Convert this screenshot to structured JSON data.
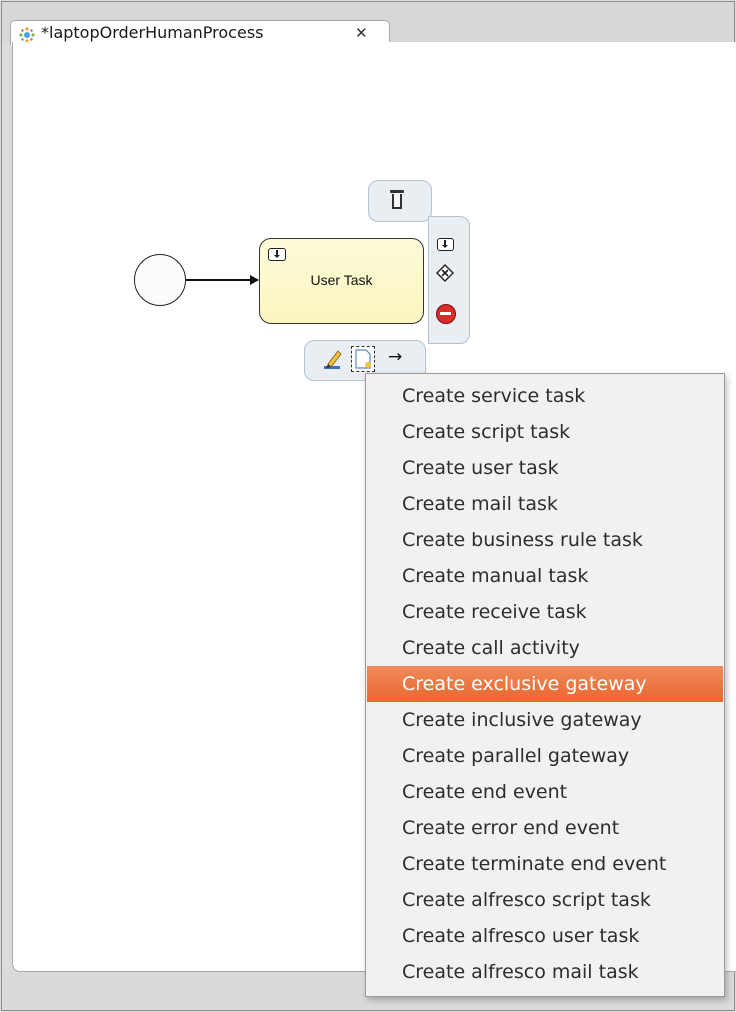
{
  "editor": {
    "tab_title": "*laptopOrderHumanProcess",
    "tab_close_glyph": "✕",
    "tab_icon": "process-diagram-icon"
  },
  "diagram": {
    "task_label": "User Task"
  },
  "context_pad": {
    "icons": [
      "trash-icon",
      "subprocess-icon",
      "gateway-icon",
      "end-event-icon",
      "edit-icon",
      "new-shape-icon",
      "connection-arrow-icon"
    ],
    "arrow_glyph": "→"
  },
  "context_menu": {
    "items": [
      {
        "label": "Create service task",
        "selected": false
      },
      {
        "label": "Create script task",
        "selected": false
      },
      {
        "label": "Create user task",
        "selected": false
      },
      {
        "label": "Create mail task",
        "selected": false
      },
      {
        "label": "Create business rule task",
        "selected": false
      },
      {
        "label": "Create manual task",
        "selected": false
      },
      {
        "label": "Create receive task",
        "selected": false
      },
      {
        "label": "Create call activity",
        "selected": false
      },
      {
        "label": "Create exclusive gateway",
        "selected": true
      },
      {
        "label": "Create inclusive gateway",
        "selected": false
      },
      {
        "label": "Create parallel gateway",
        "selected": false
      },
      {
        "label": "Create end event",
        "selected": false
      },
      {
        "label": "Create error end event",
        "selected": false
      },
      {
        "label": "Create terminate end event",
        "selected": false
      },
      {
        "label": "Create alfresco script task",
        "selected": false
      },
      {
        "label": "Create alfresco user task",
        "selected": false
      },
      {
        "label": "Create alfresco mail task",
        "selected": false
      }
    ]
  },
  "colors": {
    "selection": "#e8672f",
    "task_fill": "#fbf5bf",
    "pad_fill": "#e9eef3",
    "end_event": "#dd2a2a"
  }
}
